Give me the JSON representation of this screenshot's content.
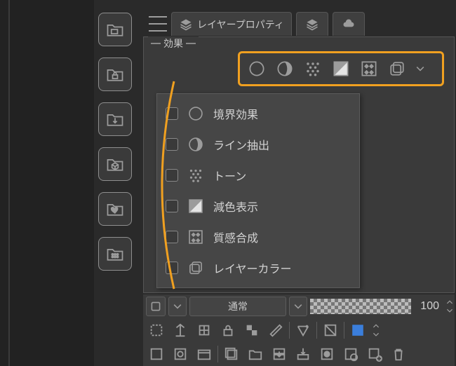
{
  "topbar": {
    "tab_title": "レイヤープロパティ"
  },
  "effects_panel": {
    "legend": "効果"
  },
  "effect_toolbar": {
    "items": [
      "border-outline",
      "sphere-shade",
      "tone",
      "reduce-color",
      "texture",
      "layer-color"
    ]
  },
  "effects_list": [
    {
      "icon": "border-outline",
      "label": "境界効果"
    },
    {
      "icon": "sphere-shade",
      "label": "ライン抽出"
    },
    {
      "icon": "tone",
      "label": "トーン"
    },
    {
      "icon": "reduce-color",
      "label": "減色表示"
    },
    {
      "icon": "texture",
      "label": "質感合成"
    },
    {
      "icon": "layer-color",
      "label": "レイヤーカラー"
    }
  ],
  "layers_panel": {
    "blend_mode": "通常",
    "opacity_value": "100"
  }
}
